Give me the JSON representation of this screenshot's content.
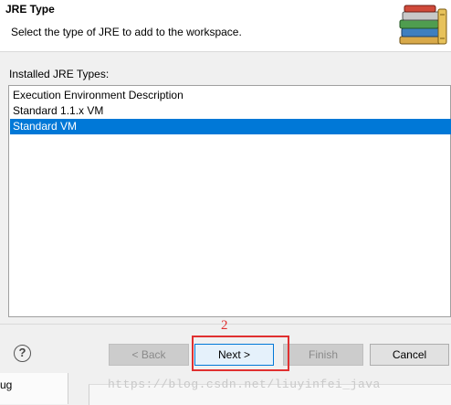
{
  "header": {
    "title": "JRE Type",
    "subtitle": "Select the type of JRE to add to the workspace.",
    "icon": "books-icon"
  },
  "list": {
    "label": "Installed JRE Types:",
    "items": [
      {
        "label": "Execution Environment Description",
        "selected": false
      },
      {
        "label": "Standard 1.1.x VM",
        "selected": false
      },
      {
        "label": "Standard VM",
        "selected": true
      }
    ]
  },
  "footer": {
    "help_icon": "?",
    "back_label": "< Back",
    "next_label": "Next >",
    "finish_label": "Finish",
    "cancel_label": "Cancel"
  },
  "annotation": {
    "number": "2",
    "color": "#e03030"
  },
  "background": {
    "left_text": "ug",
    "watermark": "https://blog.csdn.net/liuyinfei_java"
  },
  "colors": {
    "selection": "#0078d7",
    "default_button_border": "#0078d7"
  }
}
